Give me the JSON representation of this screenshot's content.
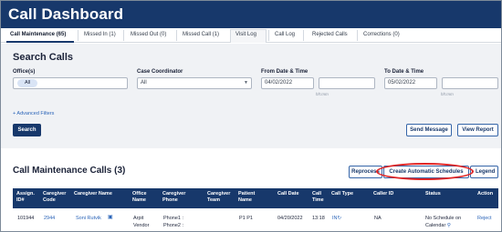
{
  "app": {
    "title": "Call Dashboard"
  },
  "tabs": [
    {
      "label": "Call Maintenance",
      "count": "(65)",
      "active": true
    },
    {
      "label": "Missed In",
      "count": "(1)"
    },
    {
      "label": "Missed Out",
      "count": "(0)"
    },
    {
      "label": "Missed Call",
      "count": "(1)"
    },
    {
      "label": "Visit Log",
      "count": ""
    },
    {
      "label": "Call Log",
      "count": ""
    },
    {
      "label": "Rejected Calls",
      "count": ""
    },
    {
      "label": "Corrections",
      "count": "(0)"
    }
  ],
  "search": {
    "title": "Search Calls",
    "office": {
      "label": "Office(s)",
      "chip": "All"
    },
    "coordinator": {
      "label": "Case Coordinator",
      "value": "All"
    },
    "from": {
      "label": "From Date & Time",
      "date": "04/02/2022",
      "time_hint": "hh:mm"
    },
    "to": {
      "label": "To Date & Time",
      "date": "05/02/2022",
      "time_hint": "hh:mm"
    },
    "advanced_filters": "+ Advanced Filters",
    "search_button": "Search",
    "send_message_button": "Send Message",
    "view_report_button": "View Report"
  },
  "calls": {
    "title": "Call Maintenance Calls (3)",
    "reprocess_button": "Reprocess",
    "create_schedules_button": "Create Automatic Schedules",
    "legend_button": "Legend",
    "columns": [
      [
        "Assign.",
        "ID#"
      ],
      [
        "Caregiver",
        "Code"
      ],
      [
        "Caregiver Name",
        ""
      ],
      [
        "Office",
        "Name"
      ],
      [
        "Caregiver",
        "Phone"
      ],
      [
        "Caregiver",
        "Team"
      ],
      [
        "Patient",
        "Name"
      ],
      [
        "Call Date",
        ""
      ],
      [
        "Call",
        "Time"
      ],
      [
        "Call Type",
        ""
      ],
      [
        "Caller ID",
        ""
      ],
      [
        "Status",
        ""
      ],
      [
        "Action",
        ""
      ]
    ],
    "rows": [
      {
        "assign_id": "101944",
        "caregiver_code": "2944",
        "caregiver_name": "Soni Rutvik",
        "office_line1": "Arpit",
        "office_line2": "Vendor",
        "phone_line1": "Phone1 :",
        "phone_line2": "Phone2 :",
        "team": "",
        "patient": "P1 P1",
        "call_date": "04/20/2022",
        "call_time": "13:18",
        "call_type": "IN",
        "caller_id": "NA",
        "status_line1": "No Schedule on",
        "status_line2": "Calendar",
        "action": "Reject"
      }
    ]
  },
  "icons": {
    "caregiver_card": "id-card-icon",
    "call_in": "phone-in-icon",
    "location": "location-pin-icon",
    "dropdown": "chevron-down-icon"
  },
  "colors": {
    "header": "#17386b",
    "accent_link": "#2a64b8",
    "highlight": "#e02424",
    "panel": "#f0f2f5"
  }
}
